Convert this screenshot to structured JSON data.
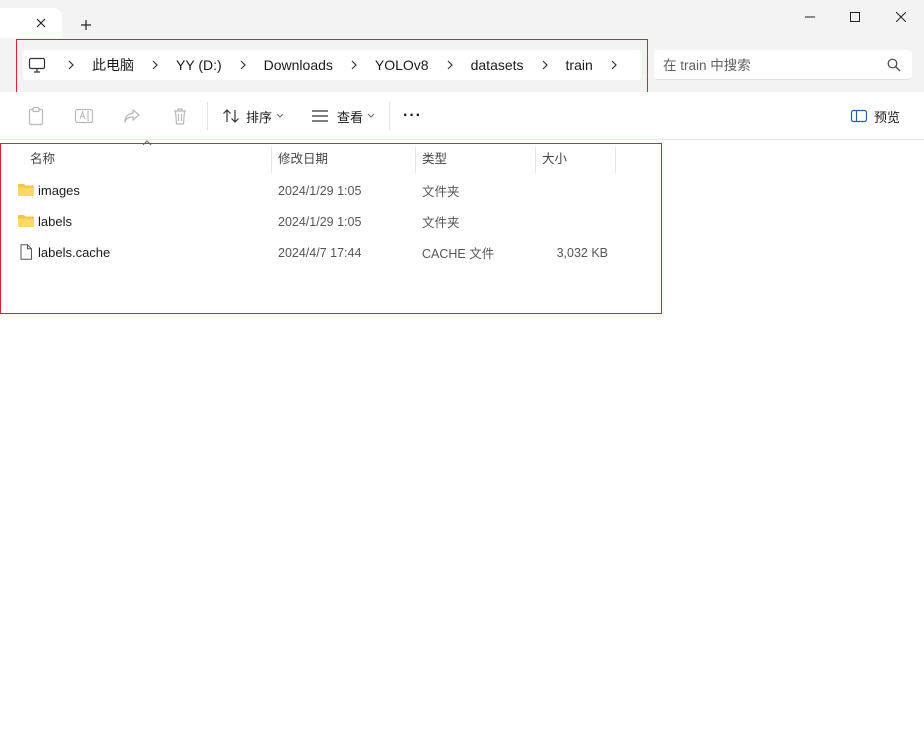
{
  "window": {
    "tab_close_glyph": "×",
    "new_tab_glyph": "+"
  },
  "address": {
    "crumbs": [
      "此电脑",
      "YY (D:)",
      "Downloads",
      "YOLOv8",
      "datasets",
      "train"
    ]
  },
  "search": {
    "placeholder": "在 train 中搜索"
  },
  "toolbar": {
    "sort_label": "排序",
    "view_label": "查看",
    "more_label": "···",
    "preview_label": "预览"
  },
  "columns": {
    "name": "名称",
    "date": "修改日期",
    "type": "类型",
    "size": "大小"
  },
  "files": [
    {
      "name": "images",
      "date": "2024/1/29 1:05",
      "type": "文件夹",
      "size": "",
      "icon": "folder-icon"
    },
    {
      "name": "labels",
      "date": "2024/1/29 1:05",
      "type": "文件夹",
      "size": "",
      "icon": "folder-icon"
    },
    {
      "name": "labels.cache",
      "date": "2024/4/7 17:44",
      "type": "CACHE 文件",
      "size": "3,032 KB",
      "icon": "file-icon"
    }
  ],
  "colors": {
    "accent_folder": "#f5c440",
    "annotation_red": "#e0202a",
    "chrome_bg": "#f3f3f3"
  }
}
